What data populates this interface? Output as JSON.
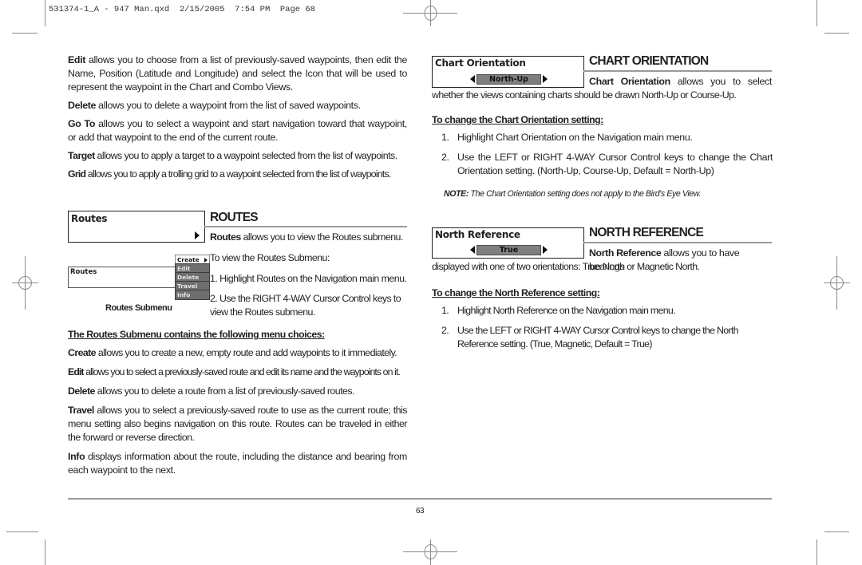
{
  "slug": "531374-1_A - 947 Man.qxd  2/15/2005  7:54 PM  Page 68",
  "left_column": {
    "waypoint_options": [
      {
        "term": "Edit",
        "text": " allows you to choose from a list of previously-saved waypoints, then edit the Name, Position (Latitude and Longitude) and select the Icon that will be used to represent the waypoint in the Chart and Combo Views."
      },
      {
        "term": "Delete",
        "text": " allows you to delete a waypoint from the list of saved waypoints."
      },
      {
        "term": "Go To",
        "text": " allows you to select a waypoint and start navigation toward that waypoint, or add that waypoint to the end of the current route."
      },
      {
        "term": "Target",
        "text": " allows you to apply a target to a waypoint selected from the list of waypoints."
      },
      {
        "term": "Grid",
        "text": " allows you to apply a trolling grid to a waypoint selected from the list of waypoints."
      }
    ],
    "routes_menu_box": {
      "title": "Routes",
      "arrow_icon": "right-triangle-icon"
    },
    "routes_heading": "ROUTES",
    "routes_intro": {
      "term": "Routes",
      "text": " allows you to view the Routes submenu."
    },
    "routes_view_label": "To view the Routes Submenu:",
    "routes_steps": [
      "1. Highlight Routes on the Navigation main menu.",
      "2. Use the RIGHT 4-WAY Cursor Control keys to view the Routes submenu."
    ],
    "submenu_figure": {
      "menu_label": "Routes",
      "items": [
        "Create",
        "Edit",
        "Delete",
        "Travel",
        "Info"
      ],
      "caption": "Routes Submenu"
    },
    "submenu_choices_heading": "The Routes Submenu contains the following menu choices:",
    "submenu_choices": [
      {
        "term": "Create",
        "text": " allows you to create a new, empty route and add waypoints to it immediately."
      },
      {
        "term": "Edit",
        "text": " allows you to select a previously-saved route and edit its name and the waypoints on it."
      },
      {
        "term": "Delete",
        "text": " allows you to delete a route from a list of previously-saved routes."
      },
      {
        "term": "Travel",
        "text": " allows you to select a previously-saved route to use as the current route; this menu setting also begins navigation on this route. Routes can be traveled in either the forward or reverse direction."
      },
      {
        "term": "Info",
        "text": " displays information about the route, including the distance and bearing from each waypoint to the next."
      }
    ]
  },
  "right_column": {
    "chart_orientation": {
      "menu_box": {
        "title": "Chart Orientation",
        "value": "North-Up"
      },
      "heading": "CHART ORIENTATION",
      "intro_term": "Chart Orientation",
      "intro_text_1": " allows you to select",
      "intro_text_2": "whether the views containing charts should be drawn North-Up or Course-Up.",
      "steps_heading": "To change the Chart Orientation setting:",
      "steps": [
        {
          "num": "1.",
          "text": "Highlight Chart Orientation on the Navigation main menu."
        },
        {
          "num": "2.",
          "text": "Use the LEFT or RIGHT 4-WAY Cursor Control keys to change the Chart Orientation setting. (North-Up, Course-Up, Default = North-Up)"
        }
      ],
      "note_label": "NOTE:",
      "note_text": " The Chart Orientation setting does not apply to the Bird's Eye View."
    },
    "north_reference": {
      "menu_box": {
        "title": "North Reference",
        "value": "True"
      },
      "heading": "NORTH REFERENCE",
      "intro_term": "North Reference",
      "intro_text_1": " allows you to have bearings",
      "intro_text_2": "displayed with one of two orientations: True North or Magnetic North.",
      "steps_heading": "To change the North Reference setting:",
      "steps": [
        {
          "num": "1.",
          "text": "Highlight North Reference on the Navigation main menu."
        },
        {
          "num": "2.",
          "text": "Use the LEFT or RIGHT 4-WAY Cursor Control keys to change the North Reference setting. (True, Magnetic, Default = True)"
        }
      ]
    }
  },
  "footer": {
    "page_number": "63"
  }
}
